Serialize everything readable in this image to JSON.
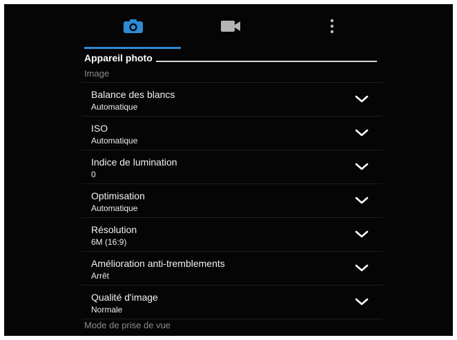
{
  "tabs": [
    {
      "icon": "camera-icon",
      "selected": true
    },
    {
      "icon": "video-camera-icon",
      "selected": false
    },
    {
      "icon": "more-vertical-icon",
      "selected": false
    }
  ],
  "accent_color": "#2e8bd6",
  "section": {
    "title": "Appareil photo"
  },
  "groups": {
    "image": "Image",
    "capture_mode": "Mode de prise de vue"
  },
  "settings": [
    {
      "label": "Balance des blancs",
      "value": "Automatique"
    },
    {
      "label": "ISO",
      "value": "Automatique"
    },
    {
      "label": "Indice de lumination",
      "value": "0"
    },
    {
      "label": "Optimisation",
      "value": "Automatique"
    },
    {
      "label": "Résolution",
      "value": "6M (16:9)"
    },
    {
      "label": "Amélioration anti-tremblements",
      "value": "Arrêt"
    },
    {
      "label": "Qualité d'image",
      "value": "Normale"
    }
  ]
}
